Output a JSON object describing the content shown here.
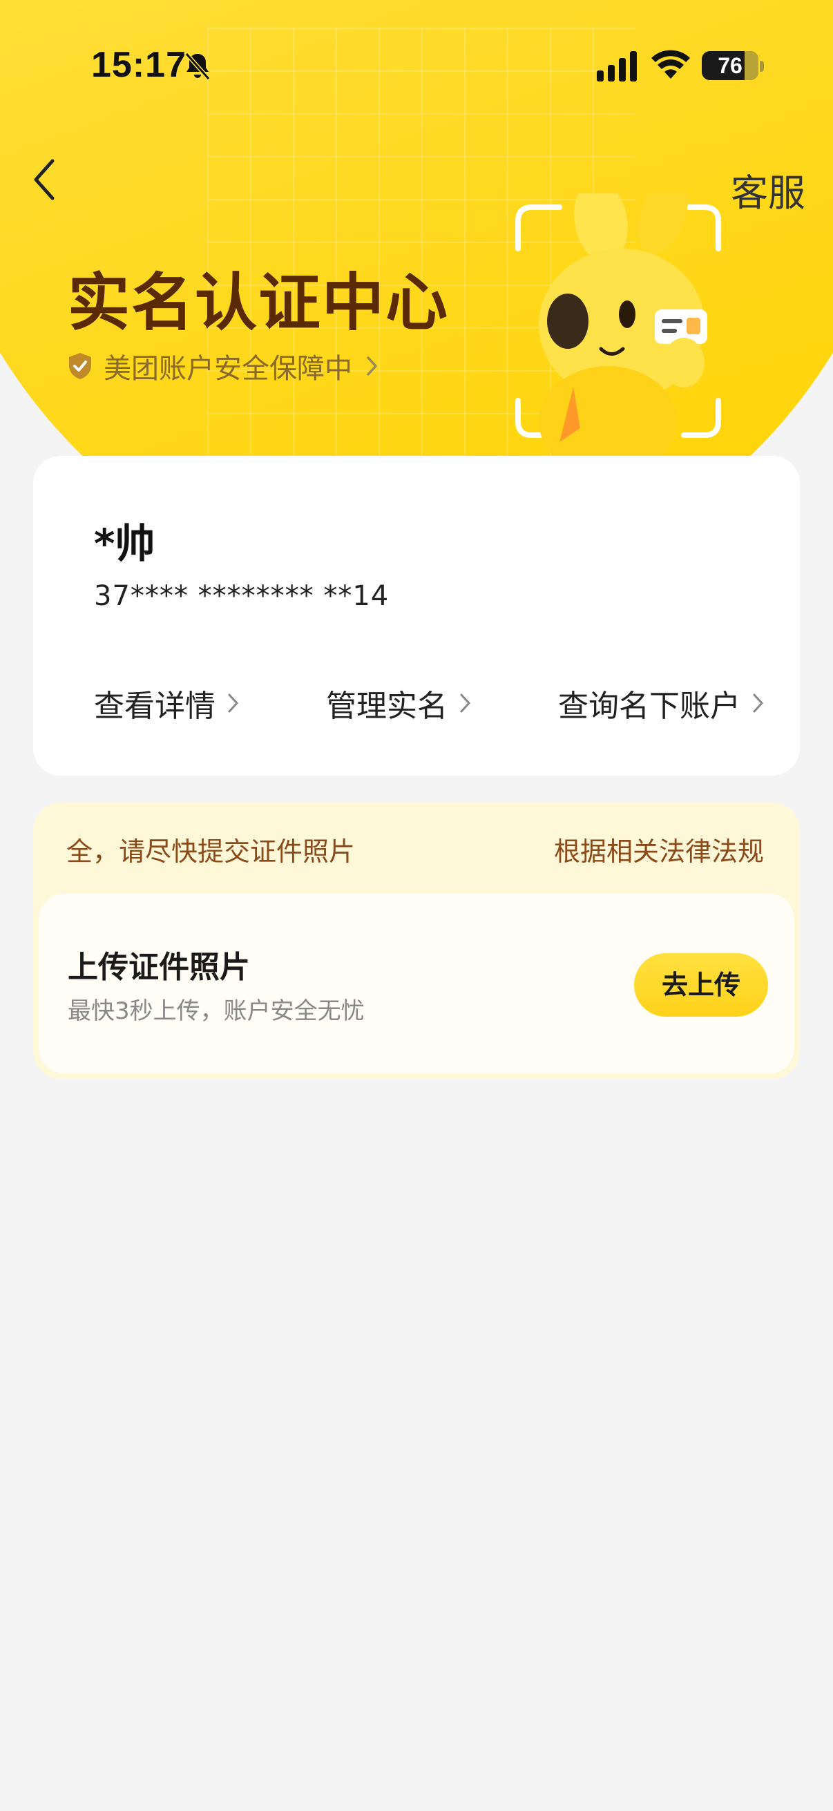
{
  "status_bar": {
    "time": "15:17",
    "battery": "76",
    "battery_level": 0.76
  },
  "nav": {
    "back_icon": "chevron-left-icon",
    "service_label": "客服"
  },
  "hero": {
    "title": "实名认证中心",
    "security_text": "美团账户安全保障中"
  },
  "identity": {
    "name": "*帅",
    "id_number": "37**** ******** **14",
    "actions": [
      {
        "label": "查看详情"
      },
      {
        "label": "管理实名"
      },
      {
        "label": "查询名下账户"
      }
    ]
  },
  "upload": {
    "notice_left": "全，请尽快提交证件照片",
    "notice_right": "根据相关法律法规",
    "title": "上传证件照片",
    "subtitle": "最快3秒上传，账户安全无忧",
    "button_label": "去上传"
  },
  "colors": {
    "brand_yellow": "#ffd21a",
    "title_brown": "#5a2a07",
    "notice_bg": "#fff8d8"
  }
}
